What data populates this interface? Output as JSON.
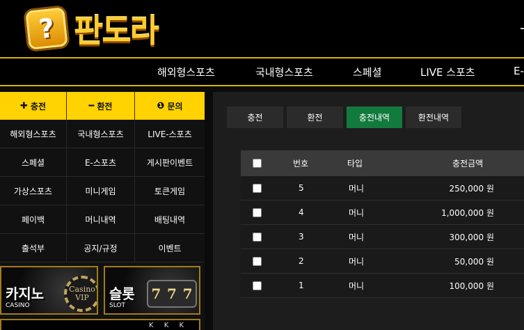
{
  "brand": {
    "logo_glyph": "?",
    "name": "판도라",
    "accent": "#ffd200",
    "active_tab_color": "#137a3d"
  },
  "topnav": {
    "items": [
      "해외형스포츠",
      "국내형스포츠",
      "스페셜",
      "LIVE 스포츠",
      "E-"
    ]
  },
  "quick": {
    "charge": "충전",
    "exchange": "환전",
    "inquiry": "문의"
  },
  "menu": [
    [
      "해외형스포츠",
      "국내형스포츠",
      "LIVE-스포츠"
    ],
    [
      "스페셜",
      "E-스포츠",
      "게시판이벤트"
    ],
    [
      "가상스포츠",
      "미니게임",
      "토큰게임"
    ],
    [
      "페이백",
      "머니내역",
      "배팅내역"
    ],
    [
      "출석부",
      "공지/규정",
      "이벤트"
    ]
  ],
  "banners": {
    "casino": {
      "title": "카지노",
      "sub": "CASINO",
      "chip_top": "Casino",
      "chip_bottom": "VIP"
    },
    "slot": {
      "title": "슬롯",
      "sub": "SLOT",
      "reels": [
        "7",
        "7",
        "7"
      ]
    },
    "cards": "K K K"
  },
  "tabs": [
    "충전",
    "환전",
    "충전내역",
    "환전내역"
  ],
  "table": {
    "headers": [
      "번호",
      "타입",
      "충전금액"
    ],
    "rows": [
      {
        "no": "5",
        "type": "머니",
        "amount": "250,000 원"
      },
      {
        "no": "4",
        "type": "머니",
        "amount": "1,000,000 원"
      },
      {
        "no": "3",
        "type": "머니",
        "amount": "300,000 원"
      },
      {
        "no": "2",
        "type": "머니",
        "amount": "50,000 원"
      },
      {
        "no": "1",
        "type": "머니",
        "amount": "100,000 원"
      }
    ]
  }
}
